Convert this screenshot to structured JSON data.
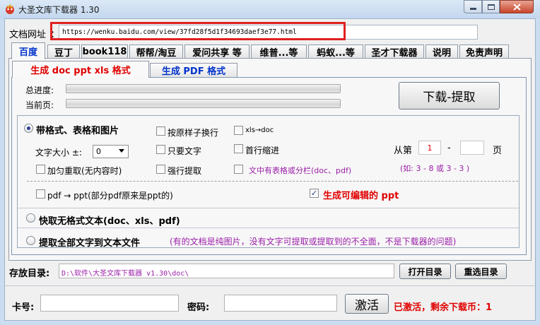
{
  "window": {
    "title": "大圣文库下载器 1.30"
  },
  "url": {
    "label": "文档网址",
    "colon": "：",
    "value": "https://wenku.baidu.com/view/37fd28f5d1f34693daef3e77.html"
  },
  "tabs": [
    {
      "label": "百度",
      "active": true
    },
    {
      "label": "豆丁"
    },
    {
      "label": "book118"
    },
    {
      "label": "帮帮/淘豆"
    },
    {
      "label": "爱问共享 等"
    },
    {
      "label": "维普...等"
    },
    {
      "label": "蚂蚁...等"
    },
    {
      "label": "圣才下载器"
    },
    {
      "label": "说明"
    },
    {
      "label": "免责声明"
    }
  ],
  "subtabs": {
    "doc": "生成 doc ppt xls 格式",
    "pdf": "生成 PDF 格式"
  },
  "progress": {
    "total_label": "总进度:",
    "page_label": "当前页:",
    "total": 0,
    "page": 0
  },
  "download_button": "下载-提取",
  "options": {
    "with_format": "带格式、表格和图片",
    "by_sample_linebreak": "按原样子换行",
    "xls_to_doc": "xls→doc",
    "font_size_label": "文字大小 ±:",
    "font_size_value": "0",
    "text_only": "只要文字",
    "first_line_indent": "首行缩进",
    "bold_retry": "加匀重取(无内容时)",
    "force_extract": "强行提取",
    "has_table_note": "文中有表格或分栏(doc、pdf)",
    "from_page_label": "从第",
    "from_page": "1",
    "dash": "-",
    "to_page": "",
    "page_suffix": "页",
    "page_example": "(如: 3 - 8  或 3 - 3 )",
    "pdf_to_ppt": "pdf → ppt(部分pdf原来是ppt的)",
    "editable_ppt": "生成可编辑的 ppt",
    "editable_ppt_check": "✓",
    "quick_plain": "快取无格式文本(doc、xls、pdf)",
    "extract_all": "提取全部文字到文本文件",
    "extract_note": "(有的文档是纯图片，没有文字可提取或提取到的不全面，不是下载器的问题)"
  },
  "storage": {
    "label": "存放目录:",
    "path": "D:\\软件\\大圣文库下载器 v1.30\\doc\\",
    "open_button": "打开目录",
    "reselect_button": "重选目录"
  },
  "activation": {
    "card_label": "卡号:",
    "password_label": "密码:",
    "activate_button": "激活",
    "status": "已激活，剩余下载币：1"
  },
  "colors": {
    "accent_red": "#e00000",
    "accent_blue": "#0033cc",
    "note_purple": "#9b1fa8",
    "highlight_red": "#e02020"
  }
}
